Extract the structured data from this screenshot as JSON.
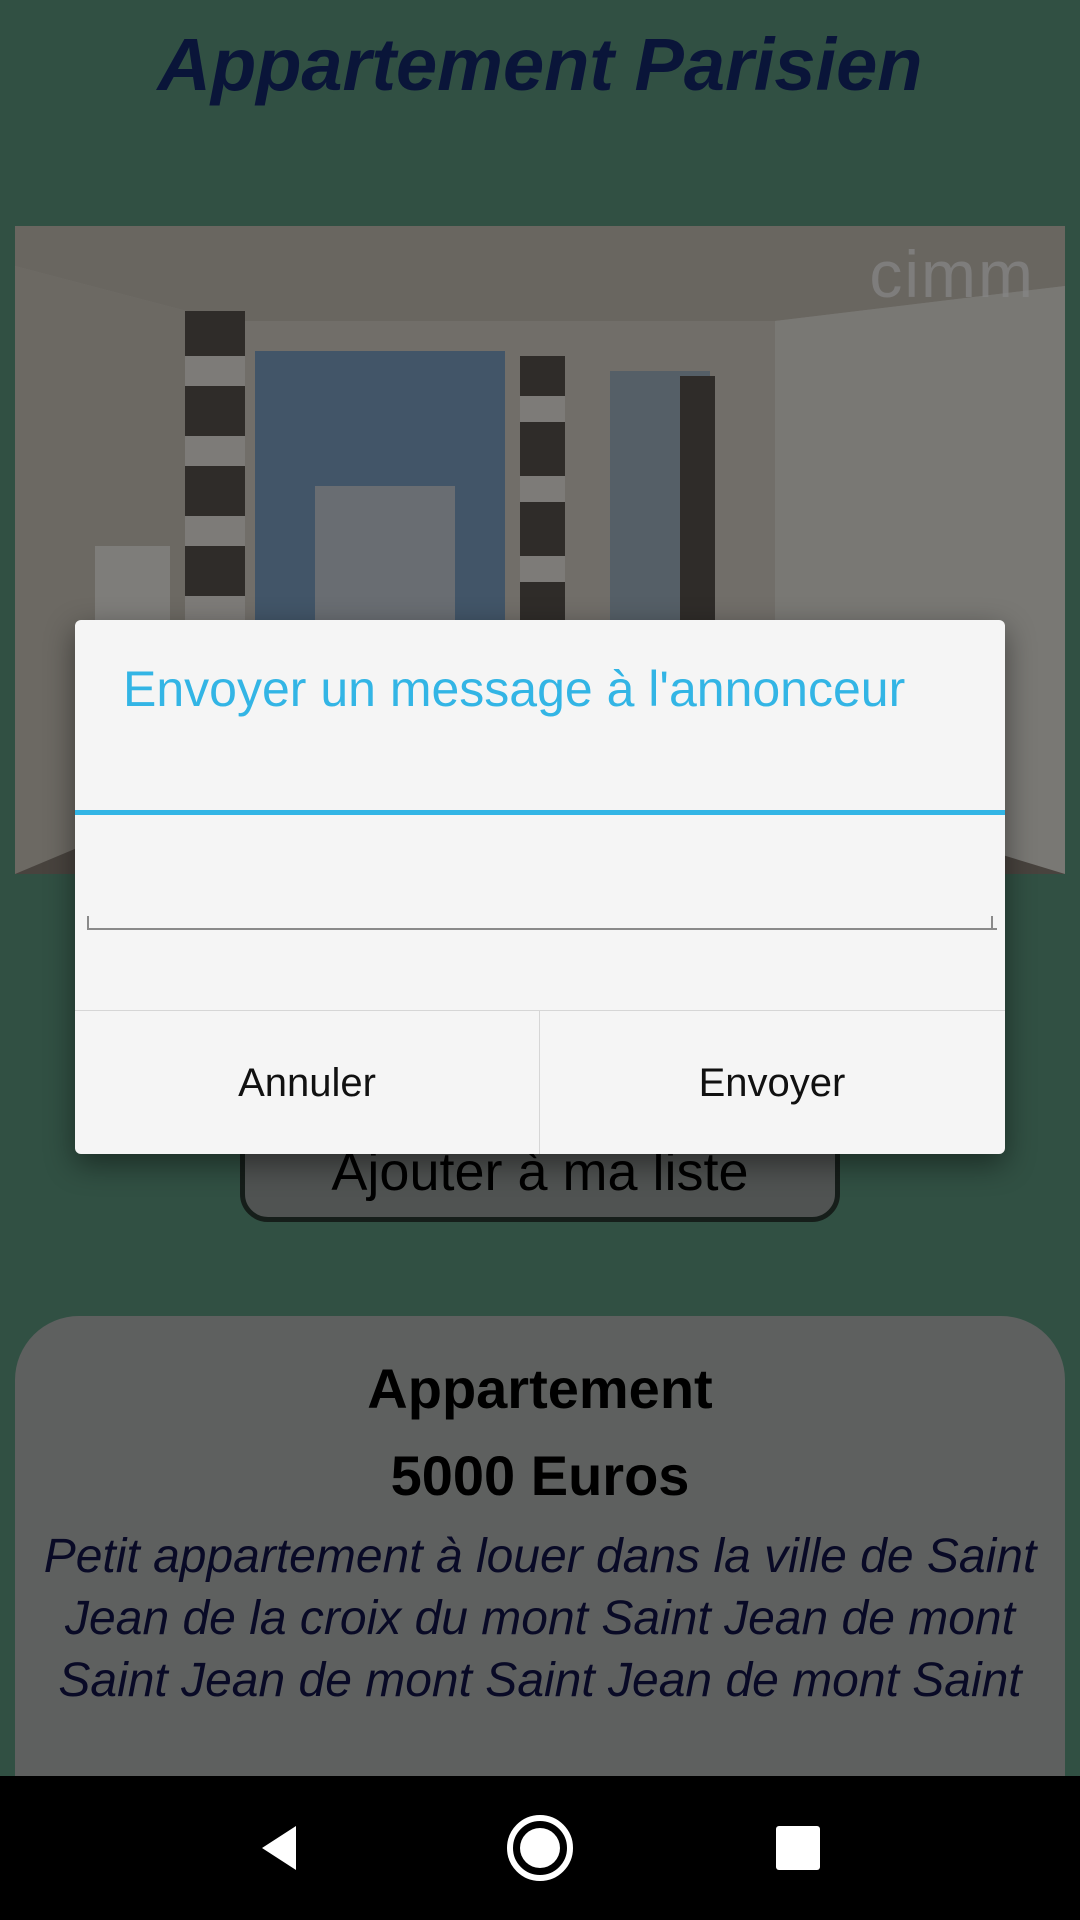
{
  "page": {
    "title": "Appartement Parisien",
    "background_color": "#5e9a80",
    "title_color": "#142a6e"
  },
  "listing": {
    "photo_icon": "apartment-photo",
    "watermark": "cimm",
    "add_to_list_label": "Ajouter à ma liste",
    "type": "Appartement",
    "price": "5000 Euros",
    "description": "Petit appartement à louer dans la ville de Saint Jean de la croix du mont Saint Jean de mont Saint Jean de mont Saint Jean de mont Saint"
  },
  "dialog": {
    "title": "Envoyer un message à l'annonceur",
    "input_value": "",
    "cancel_label": "Annuler",
    "send_label": "Envoyer",
    "accent_color": "#33b5e5"
  },
  "navbar": {
    "icons": [
      "back-icon",
      "home-icon",
      "recents-icon"
    ]
  }
}
